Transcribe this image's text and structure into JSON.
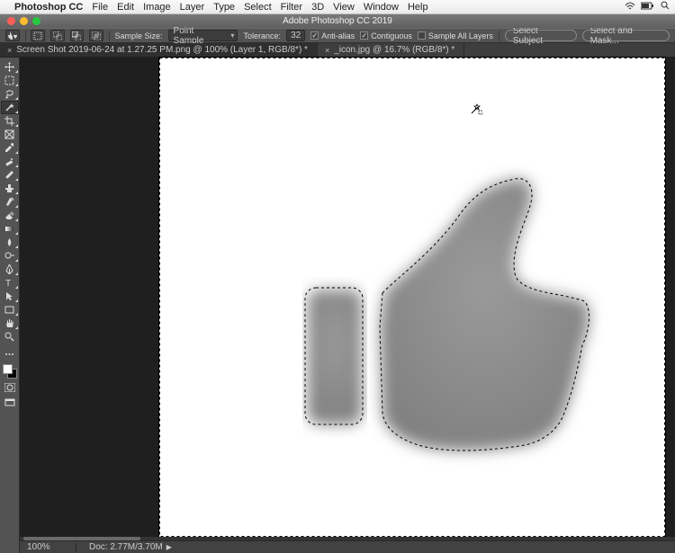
{
  "mac_menu": {
    "app": "Photoshop CC",
    "items": [
      "File",
      "Edit",
      "Image",
      "Layer",
      "Type",
      "Select",
      "Filter",
      "3D",
      "View",
      "Window",
      "Help"
    ]
  },
  "window": {
    "title": "Adobe Photoshop CC 2019"
  },
  "options": {
    "sample_size_label": "Sample Size:",
    "sample_size_value": "Point Sample",
    "tolerance_label": "Tolerance:",
    "tolerance_value": "32",
    "anti_alias": "Anti-alias",
    "contiguous": "Contiguous",
    "sample_all": "Sample All Layers",
    "select_subject": "Select Subject",
    "select_mask": "Select and Mask..."
  },
  "tabs": [
    {
      "label": "Screen Shot 2019-06-24 at 1.27.25 PM.png @ 100% (Layer 1, RGB/8*) *"
    },
    {
      "label": "_icon.jpg @ 16.7% (RGB/8*) *"
    }
  ],
  "status": {
    "zoom": "100%",
    "doc": "Doc: 2.77M/3.70M"
  }
}
